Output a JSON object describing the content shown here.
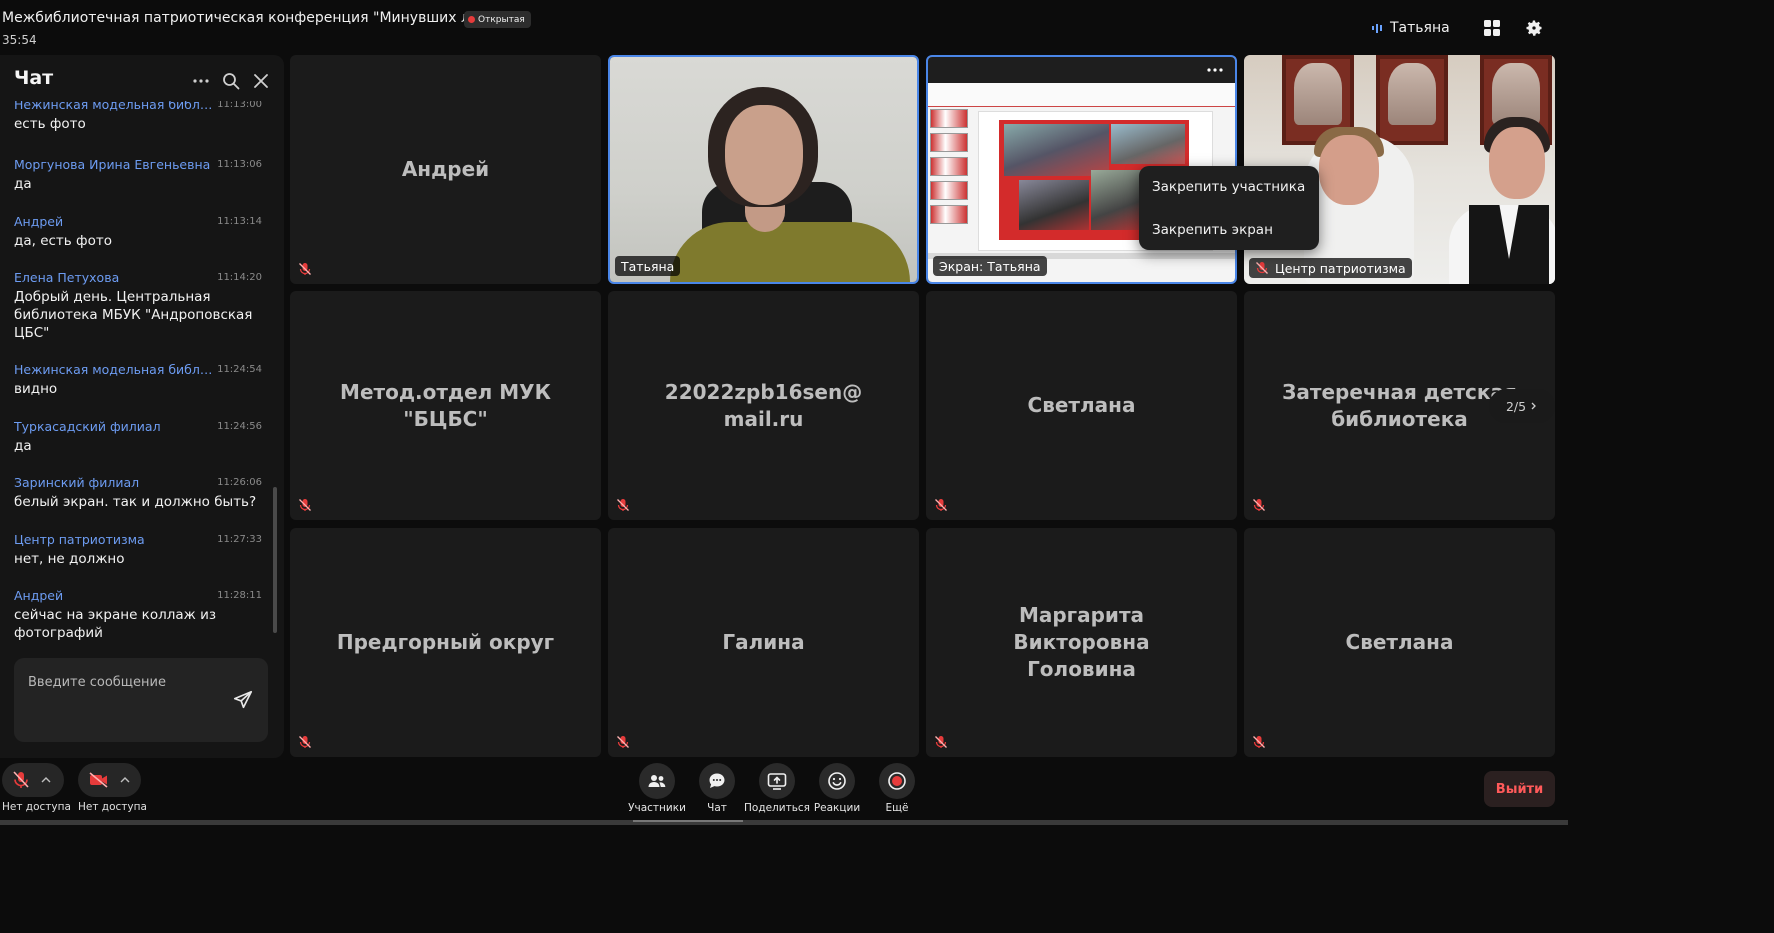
{
  "header": {
    "conference_title": "Межбиблиотечная патриотическая конференция \"Минувших ле...",
    "badge": "Открытая",
    "timer": "35:54",
    "current_user": "Татьяна"
  },
  "chat": {
    "title": "Чат",
    "input_placeholder": "Введите сообщение",
    "messages": [
      {
        "author": "Нежинская модельная библиот...",
        "time": "11:13:00",
        "text": "есть фото"
      },
      {
        "author": "Моргунова Ирина Евгеньевна",
        "time": "11:13:06",
        "text": "да"
      },
      {
        "author": "Андрей",
        "time": "11:13:14",
        "text": "да, есть фото"
      },
      {
        "author": "Елена Петухова",
        "time": "11:14:20",
        "text": "Добрый день. Центральная библиотека МБУК \"Андроповская ЦБС\""
      },
      {
        "author": "Нежинская модельная библиот...",
        "time": "11:24:54",
        "text": "видно"
      },
      {
        "author": "Туркасадский филиал",
        "time": "11:24:56",
        "text": "да"
      },
      {
        "author": "Заринский филиал",
        "time": "11:26:06",
        "text": "белый экран. так и должно быть?"
      },
      {
        "author": "Центр патриотизма",
        "time": "11:27:33",
        "text": "нет, не должно"
      },
      {
        "author": "Андрей",
        "time": "11:28:11",
        "text": "сейчас на экране коллаж из фотографий"
      }
    ]
  },
  "tiles": [
    {
      "name": "Андрей"
    },
    {
      "label": "Татьяна"
    },
    {
      "label": "Экран: Татьяна"
    },
    {
      "label": "Центр патриотизма"
    },
    {
      "name": "Метод.отдел МУК \"БЦБС\""
    },
    {
      "name": "22022zpb16sen@ mail.ru"
    },
    {
      "name": "Светлана"
    },
    {
      "name": "Затеречная детская библиотека"
    },
    {
      "name": "Предгорный округ"
    },
    {
      "name": "Галина"
    },
    {
      "name": "Маргарита Викторовна Головина"
    },
    {
      "name": "Светлана"
    }
  ],
  "context_menu": {
    "pin_participant": "Закрепить участника",
    "pin_screen": "Закрепить экран"
  },
  "pager": {
    "text": "2/5"
  },
  "controls": {
    "mic_caption": "Нет доступа",
    "cam_caption": "Нет доступа",
    "participants": "Участники",
    "chat": "Чат",
    "share": "Поделиться",
    "reactions": "Реакции",
    "more": "Ещё",
    "exit": "Выйти"
  },
  "colors": {
    "accent_blue": "#4a86e8",
    "author_blue": "#6d9cf2",
    "muted_red": "#e63b3b",
    "exit_red": "#ff5a5a"
  }
}
